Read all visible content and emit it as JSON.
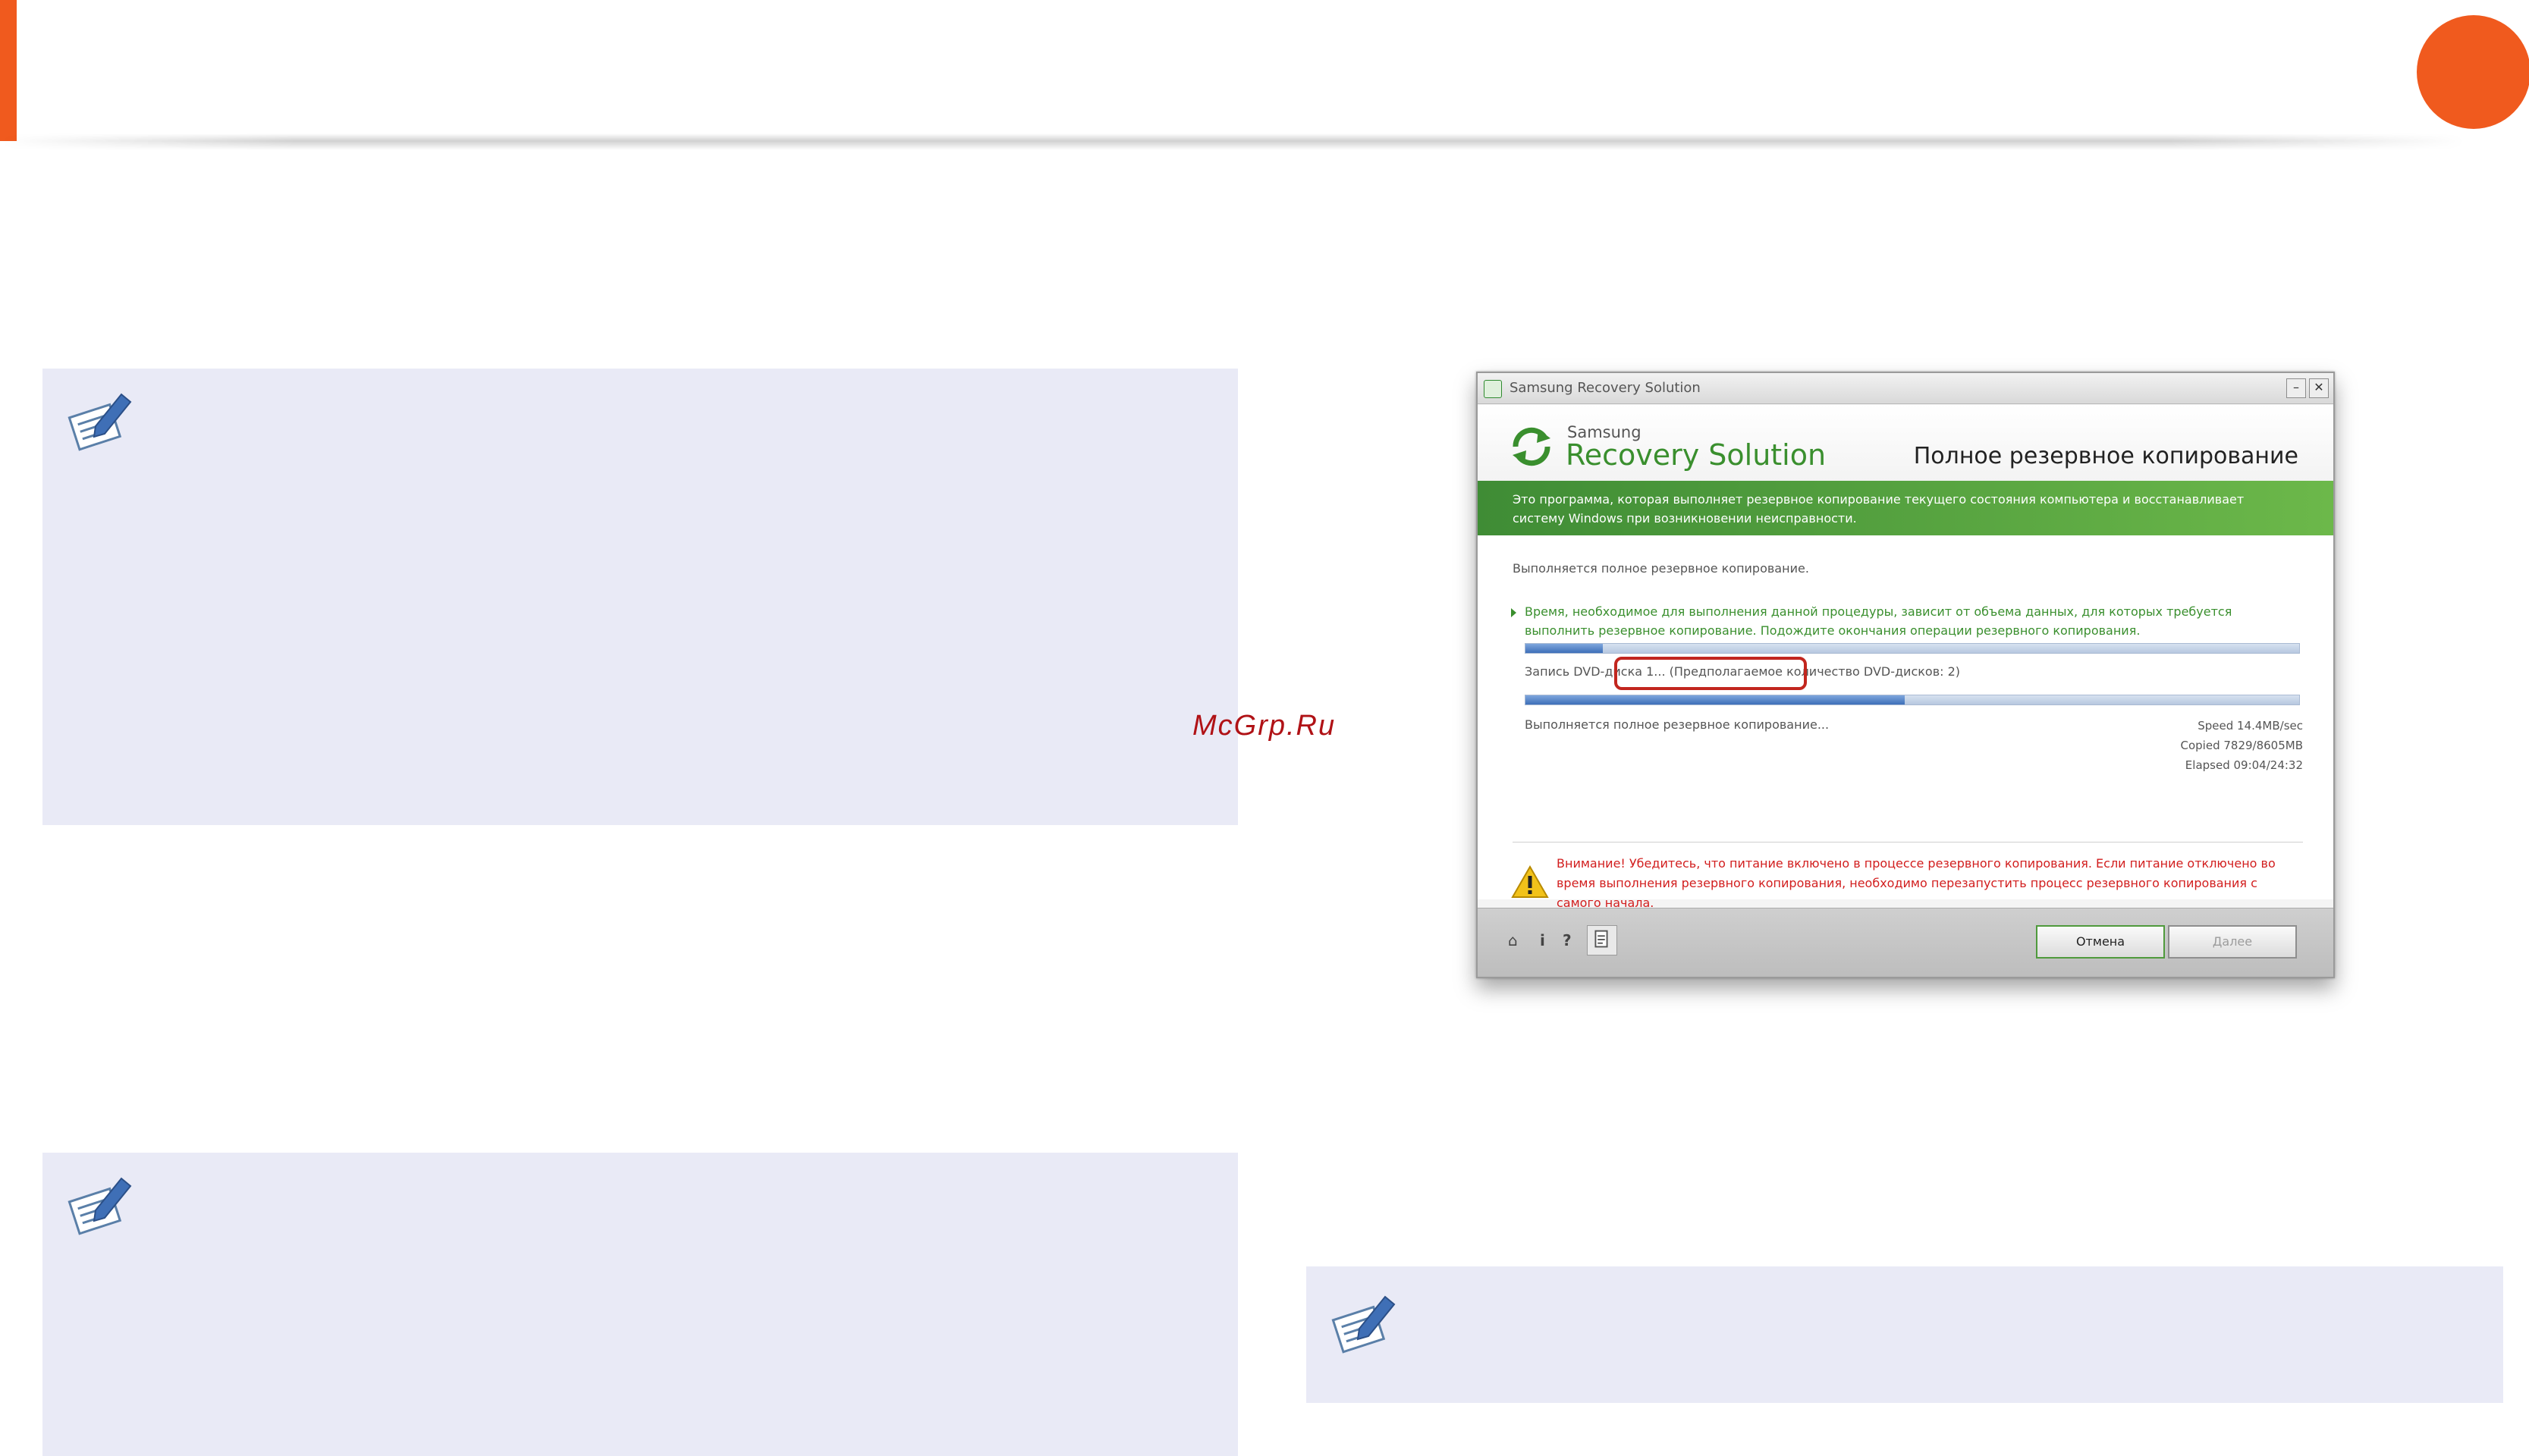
{
  "watermark": "McGrp.Ru",
  "window": {
    "title": "Samsung Recovery Solution",
    "minimize_glyph": "–",
    "close_glyph": "✕",
    "brand": {
      "small": "Samsung",
      "big": "Recovery Solution"
    },
    "section_title": "Полное резервное копирование",
    "description": "Это программа, которая выполняет резервное копирование текущего состояния компьютера и восстанавливает систему Windows при возникновении неисправности.",
    "status": "Выполняется полное резервное копирование.",
    "info": "Время, необходимое для выполнения данной процедуры, зависит от объема данных, для которых требуется выполнить резервное копирование. Подождите окончания операции резервного копирования.",
    "progress_overall": 0.1,
    "dvd_status": "Запись DVD-диска 1... (Предполагаемое количество DVD-дисков: 2)",
    "progress_dvd": 0.49,
    "working": "Выполняется полное резервное копирование...",
    "stats": {
      "speed": "Speed 14.4MB/sec",
      "copied": "Copied 7829/8605MB",
      "elapsed": "Elapsed 09:04/24:32"
    },
    "warning": "Внимание! Убедитесь, что питание включено в процессе резервного копирования. Если питание отключено во время выполнения резервного копирования, необходимо перезапустить процесс резервного копирования с самого начала.",
    "footer": {
      "home_glyph": "⌂",
      "info_glyph": "i",
      "help_glyph": "?",
      "cancel": "Отмена",
      "next": "Далее"
    }
  },
  "colors": {
    "accent": "#F05A1E",
    "note_bg": "#E9EAF6",
    "brand_green": "#3a8f2e",
    "warning_red": "#D21E1E"
  }
}
